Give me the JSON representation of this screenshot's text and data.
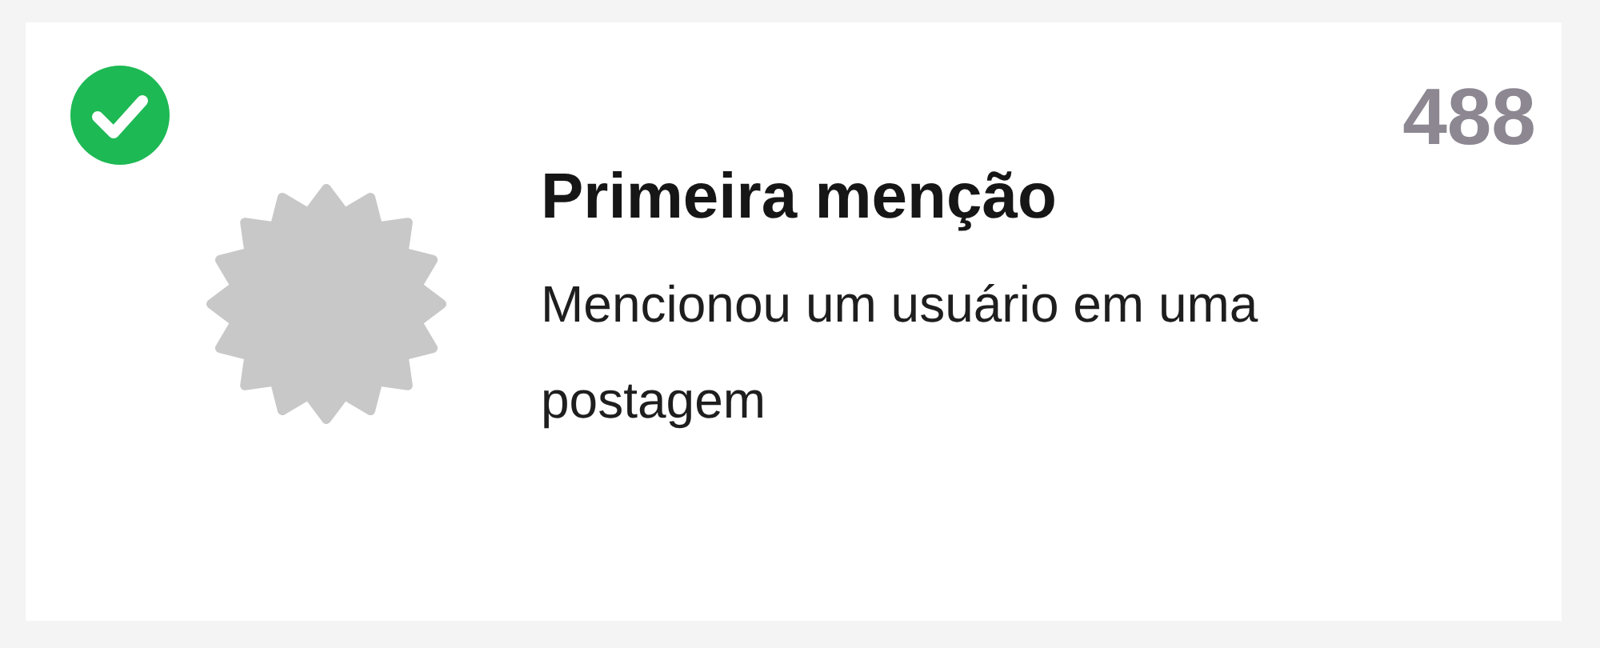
{
  "card": {
    "completed": true,
    "points": "488",
    "title": "Primeira menção",
    "description": "Mencionou um usuário em uma postagem"
  }
}
